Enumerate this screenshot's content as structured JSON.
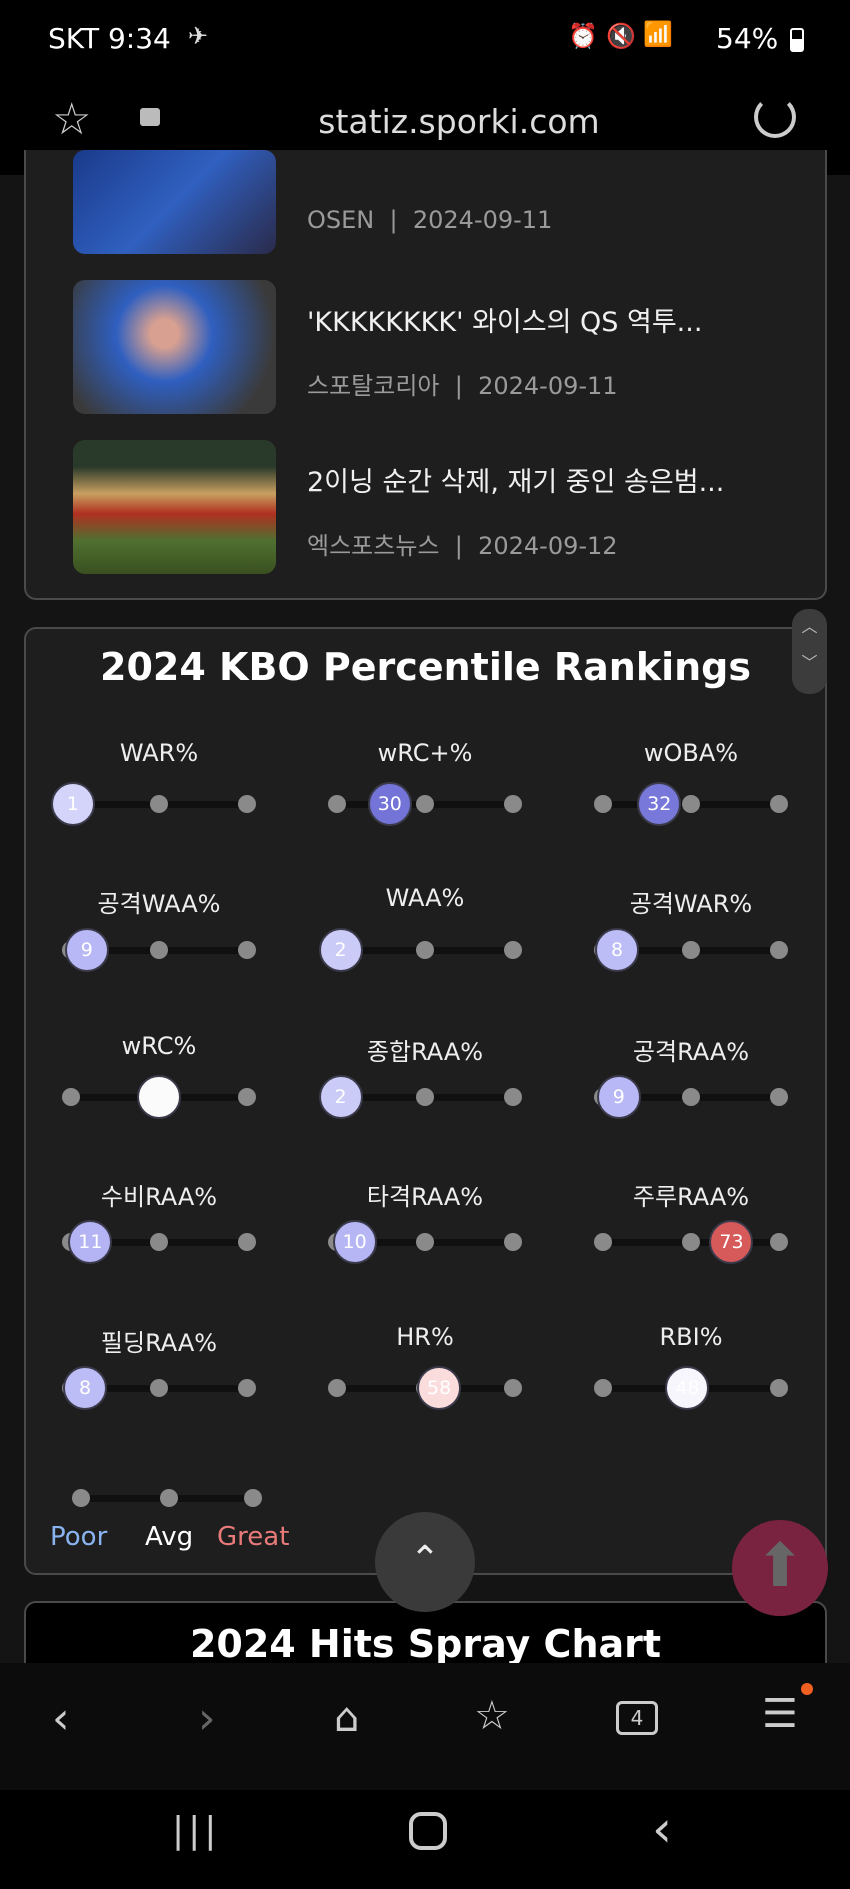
{
  "status_bar": {
    "carrier_time": "SKT 9:34",
    "battery": "54%"
  },
  "browser": {
    "url": "statiz.sporki.com",
    "tab_count": "4"
  },
  "news": [
    {
      "title": "",
      "source": "OSEN",
      "date": "2024-09-11"
    },
    {
      "title": "'KKKKKKKK' 와이스의 QS 역투...",
      "source": "스포탈코리아",
      "date": "2024-09-11"
    },
    {
      "title": "2이닝 순간 삭제, 재기 중인 송은범...",
      "source": "엑스포츠뉴스",
      "date": "2024-09-12"
    }
  ],
  "percentile": {
    "title": "2024 KBO Percentile Rankings",
    "items": [
      {
        "label": "WAR%",
        "value": 1,
        "text": "1",
        "color": "#d4d4fa"
      },
      {
        "label": "wRC+%",
        "value": 30,
        "text": "30",
        "color": "#7474d8"
      },
      {
        "label": "wOBA%",
        "value": 32,
        "text": "32",
        "color": "#7878da"
      },
      {
        "label": "공격WAA%",
        "value": 9,
        "text": "9",
        "color": "#b8b8f6"
      },
      {
        "label": "WAA%",
        "value": 2,
        "text": "2",
        "color": "#cbcbf8"
      },
      {
        "label": "공격WAR%",
        "value": 8,
        "text": "8",
        "color": "#bcbcf6"
      },
      {
        "label": "wRC%",
        "value": 50,
        "text": "",
        "color": "#fbfbfb"
      },
      {
        "label": "종합RAA%",
        "value": 2,
        "text": "2",
        "color": "#cbcbf8"
      },
      {
        "label": "공격RAA%",
        "value": 9,
        "text": "9",
        "color": "#b8b8f6"
      },
      {
        "label": "수비RAA%",
        "value": 11,
        "text": "11",
        "color": "#b4b4f5"
      },
      {
        "label": "타격RAA%",
        "value": 10,
        "text": "10",
        "color": "#b6b6f5"
      },
      {
        "label": "주루RAA%",
        "value": 73,
        "text": "73",
        "color": "#d65a5a"
      },
      {
        "label": "필딩RAA%",
        "value": 8,
        "text": "8",
        "color": "#bcbcf6"
      },
      {
        "label": "HR%",
        "value": 58,
        "text": "58",
        "color": "#fbdcdc"
      },
      {
        "label": "RBI%",
        "value": 48,
        "text": "48",
        "color": "#f6f6fc"
      }
    ],
    "legend": {
      "poor": "Poor",
      "avg": "Avg",
      "great": "Great",
      "poor_color": "#8ab4f0",
      "great_color": "#e87a7a"
    }
  },
  "next_card": {
    "title": "2024 Hits Spray Chart"
  }
}
